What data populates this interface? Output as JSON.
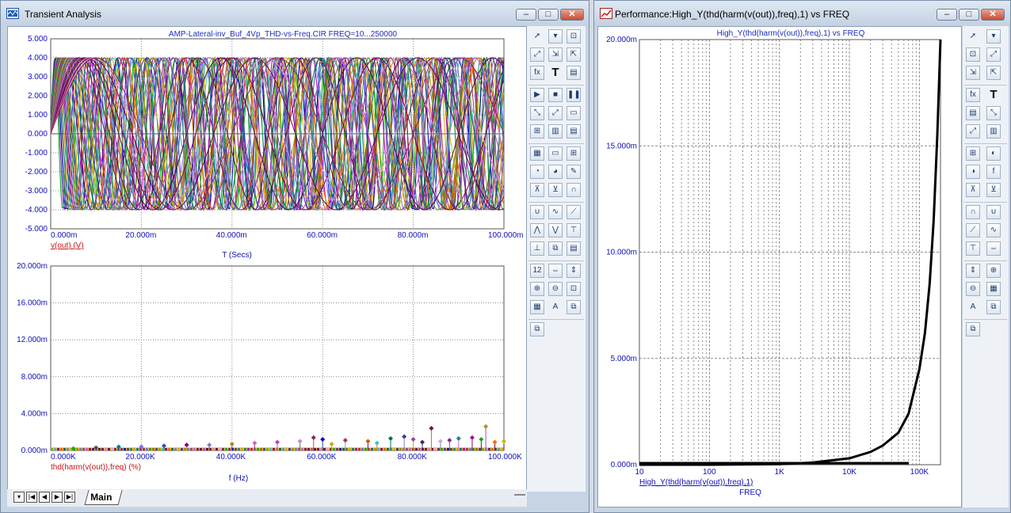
{
  "colors": {
    "axis_text": "#1010b4",
    "trace_label": "#c81414",
    "plot_title": "#1c2cc0",
    "grid": "#8a8a8a"
  },
  "transient_window": {
    "title": "Transient Analysis",
    "icon": "scope-window-icon",
    "controls": {
      "minimize": "–",
      "maximize": "□",
      "close": "✕"
    },
    "top_plot": {
      "title": "AMP-Lateral-inv_Buf_4Vp_THD-vs-Freq.CIR FREQ=10...250000",
      "y_ticks": [
        "5.000",
        "4.000",
        "3.000",
        "2.000",
        "1.000",
        "0.000",
        "-1.000",
        "-2.000",
        "-3.000",
        "-4.000",
        "-5.000"
      ],
      "x_ticks": [
        "0.000m",
        "20.000m",
        "40.000m",
        "60.000m",
        "80.000m",
        "100.000m"
      ],
      "trace_label": "v(out) (V)",
      "x_label": "T (Secs)"
    },
    "bottom_plot": {
      "y_ticks": [
        "20.000m",
        "16.000m",
        "12.000m",
        "8.000m",
        "4.000m",
        "0.000m"
      ],
      "x_ticks": [
        "0.000K",
        "20.000K",
        "40.000K",
        "60.000K",
        "80.000K",
        "100.000K"
      ],
      "trace_label": "thd(harm(v(out)),freq) (%)",
      "x_label": "f (Hz)"
    },
    "tab_label": "Main",
    "nav_buttons": [
      "▾",
      "|◀",
      "◀",
      "▶",
      "▶|"
    ]
  },
  "performance_window": {
    "title": "Performance:High_Y(thd(harm(v(out)),freq),1) vs FREQ",
    "icon": "performance-window-icon",
    "controls": {
      "minimize": "–",
      "maximize": "□",
      "close": "✕"
    },
    "plot": {
      "title": "High_Y(thd(harm(v(out)),freq),1) vs FREQ",
      "y_ticks": [
        "20.000m",
        "15.000m",
        "10.000m",
        "5.000m",
        "0.000m"
      ],
      "x_ticks": [
        "10",
        "100",
        "1K",
        "10K",
        "100K"
      ],
      "trace_label": "High_Y(thd(harm(v(out)),freq),1)",
      "x_label": "FREQ"
    }
  },
  "toolbar_icons": {
    "transient": [
      "select-arrow-icon",
      "paste-dropdown-icon",
      "scale-icon",
      "maximize-scale-icon",
      "zoom-in-icon",
      "zoom-out-icon",
      "function-icon",
      "text-icon",
      "tag-icon",
      "play-icon",
      "stop-icon",
      "pause-icon",
      "point-tag-icon",
      "data-tag-icon",
      "graph-icon",
      "grid-icon",
      "axis-icon",
      "bold-axis-icon",
      "minor-grid-icon",
      "cursor-icon",
      "stack-icon",
      "data-points-icon",
      "tokens-icon",
      "properties-icon",
      "peak-icon",
      "valley-icon",
      "high-icon",
      "low-icon",
      "inflection-icon",
      "slope-icon",
      "global-high-icon",
      "global-low-icon",
      "top-icon",
      "bottom-icon",
      "copy-icon",
      "print-icon",
      "numeric-icon",
      "horizontal-fit-icon",
      "vertical-fit-icon",
      "zoom-plus-icon",
      "zoom-minus-icon",
      "zoom-box-icon",
      "grid-layout-icon",
      "font-icon",
      "copy-left-icon",
      "copy-right-icon"
    ],
    "performance": [
      "select-arrow-icon",
      "paste-dropdown-icon",
      "scale-icon",
      "maximize-scale-icon",
      "zoom-in-icon",
      "zoom-out-icon",
      "function-icon",
      "text-icon",
      "tag-icon",
      "point-tag-icon",
      "data-tag-icon",
      "axis-icon",
      "grid-icon",
      "cursor-left-icon",
      "cursor-right-icon",
      "function-f-icon",
      "peak-icon",
      "valley-icon",
      "high-icon",
      "low-icon",
      "slope-icon",
      "inflection-icon",
      "top-icon",
      "horizontal-fit-icon",
      "vertical-fit-icon",
      "zoom-plus-icon",
      "zoom-minus-icon",
      "grid-layout-icon",
      "font-icon",
      "copy-left-icon",
      "copy-right-icon"
    ]
  },
  "chart_data": [
    {
      "type": "line",
      "title": "AMP-Lateral-inv_Buf_4Vp_THD-vs-Freq.CIR FREQ=10...250000",
      "xlabel": "T (Secs)",
      "ylabel": "v(out) (V)",
      "xlim": [
        0,
        0.1
      ],
      "ylim": [
        -5,
        5
      ],
      "grid": true,
      "amplitude": 4,
      "series_periods_s": [
        0.0035,
        0.004,
        0.0045,
        0.005,
        0.0055,
        0.006,
        0.0065,
        0.007,
        0.0075,
        0.008,
        0.0085,
        0.009,
        0.0095,
        0.01,
        0.011,
        0.012,
        0.013,
        0.014,
        0.015,
        0.016,
        0.017,
        0.018,
        0.019,
        0.02,
        0.022,
        0.024,
        0.026,
        0.028,
        0.03,
        0.032,
        0.034,
        0.036,
        0.038,
        0.04
      ],
      "series_colors": [
        "#00b400",
        "#7a2aa0",
        "#0000c8",
        "#505050",
        "#2a8080",
        "#e0a000",
        "#008080",
        "#b000b0",
        "#b03050",
        "#7070ff",
        "#20a020",
        "#c06000",
        "#3050a0",
        "#a0a000",
        "#40c0c0",
        "#800080",
        "#ff6600",
        "#007040",
        "#8080c0",
        "#c0c000",
        "#3a3a9a",
        "#b8860b",
        "#5a8fa0",
        "#a040a0",
        "#d060d0",
        "#7a1060",
        "#5a1a4a",
        "#c040c0",
        "#4a1040",
        "#800040",
        "#d080d0",
        "#6a0050",
        "#e0a0e0",
        "#8b2252"
      ]
    },
    {
      "type": "scatter",
      "xlabel": "f (Hz)",
      "ylabel": "thd(harm(v(out)),freq) (%)",
      "xlim": [
        0,
        100000
      ],
      "ylim": [
        0,
        0.02
      ],
      "grid": true,
      "points": [
        [
          5000,
          0.0002
        ],
        [
          10000,
          0.0003
        ],
        [
          15000,
          0.0004
        ],
        [
          20000,
          0.0004
        ],
        [
          25000,
          0.0005
        ],
        [
          30000,
          0.0006
        ],
        [
          35000,
          0.0006
        ],
        [
          40000,
          0.0007
        ],
        [
          45000,
          0.0008
        ],
        [
          50000,
          0.0009
        ],
        [
          55000,
          0.001
        ],
        [
          58000,
          0.0014
        ],
        [
          60000,
          0.0012
        ],
        [
          62000,
          0.0007
        ],
        [
          65000,
          0.0011
        ],
        [
          70000,
          0.001
        ],
        [
          72000,
          0.0008
        ],
        [
          75000,
          0.0013
        ],
        [
          78000,
          0.0015
        ],
        [
          80000,
          0.0012
        ],
        [
          82000,
          0.0009
        ],
        [
          84000,
          0.0024
        ],
        [
          86000,
          0.001
        ],
        [
          88000,
          0.0011
        ],
        [
          90000,
          0.0013
        ],
        [
          93000,
          0.0014
        ],
        [
          95000,
          0.0012
        ],
        [
          96000,
          0.0026
        ],
        [
          98000,
          0.0009
        ],
        [
          100000,
          0.001
        ]
      ]
    },
    {
      "type": "line",
      "title": "High_Y(thd(harm(v(out)),freq),1) vs FREQ",
      "xlabel": "FREQ",
      "ylabel": "High_Y(thd(harm(v(out)),freq),1)",
      "xscale": "log",
      "xlim": [
        10,
        200000
      ],
      "ylim": [
        0,
        0.02
      ],
      "grid": true,
      "series": [
        {
          "x": [
            10,
            100,
            1000,
            3000,
            10000,
            20000,
            30000,
            50000,
            70000,
            100000,
            120000,
            140000,
            160000,
            180000,
            200000
          ],
          "y": [
            0,
            0,
            3e-05,
            0.0001,
            0.0003,
            0.0006,
            0.0009,
            0.0015,
            0.0024,
            0.0045,
            0.0062,
            0.0085,
            0.0115,
            0.0155,
            0.02
          ]
        }
      ]
    }
  ]
}
